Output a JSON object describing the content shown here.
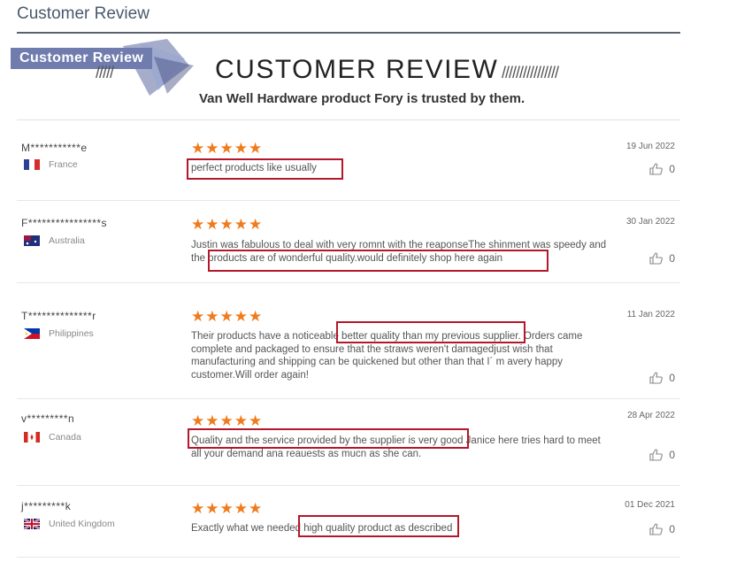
{
  "section_title": "Customer Review",
  "banner": {
    "ribbon_label": "Customer Review",
    "hero_title": "CUSTOMER REVIEW",
    "subtitle": "Van Well Hardware product Fory is trusted by them.",
    "slashes_left": "/////",
    "slashes_right": "////////////////"
  },
  "colors": {
    "accent_star": "#f07b1c",
    "highlight_border": "#b3182a",
    "ribbon": "#6f7cad"
  },
  "reviews": [
    {
      "name": "M***********e",
      "country": "France",
      "flag": "flag-france-icon",
      "stars": "★★★★★",
      "rating": 5,
      "text": "perfect products like usually",
      "date": "19 Jun 2022",
      "likes": "0"
    },
    {
      "name": "F****************s",
      "country": "Australia",
      "flag": "flag-australia-icon",
      "stars": "★★★★★",
      "rating": 5,
      "text": "Justin was fabulous to deal with very romnt with the reaponseThe shinment was speedy and the products are of wonderful quality.would definitely shop here again",
      "date": "30 Jan 2022",
      "likes": "0"
    },
    {
      "name": "T**************r",
      "country": "Philippines",
      "flag": "flag-philippines-icon",
      "stars": "★★★★★",
      "rating": 5,
      "text": "Their products have a noticeable better quality than my previous supplier. Orders came complete and packaged to ensure that the straws weren't damagedjust wish that manufacturing and shipping can be quickened but other than that I´ m avery happy customer.Will order again!",
      "date": "11 Jan 2022",
      "likes": "0"
    },
    {
      "name": "v*********n",
      "country": "Canada",
      "flag": "flag-canada-icon",
      "stars": "★★★★★",
      "rating": 5,
      "text": "Quality and the service provided by the supplier is very good Janice here tries hard to meet all your demand ana reauests as mucn as she can.",
      "date": "28 Apr 2022",
      "likes": "0"
    },
    {
      "name": "j*********k",
      "country": "United Kingdom",
      "flag": "flag-uk-icon",
      "stars": "★★★★★",
      "rating": 5,
      "text": "Exactly what we needed high quality product as described",
      "date": "01 Dec 2021",
      "likes": "0"
    }
  ]
}
